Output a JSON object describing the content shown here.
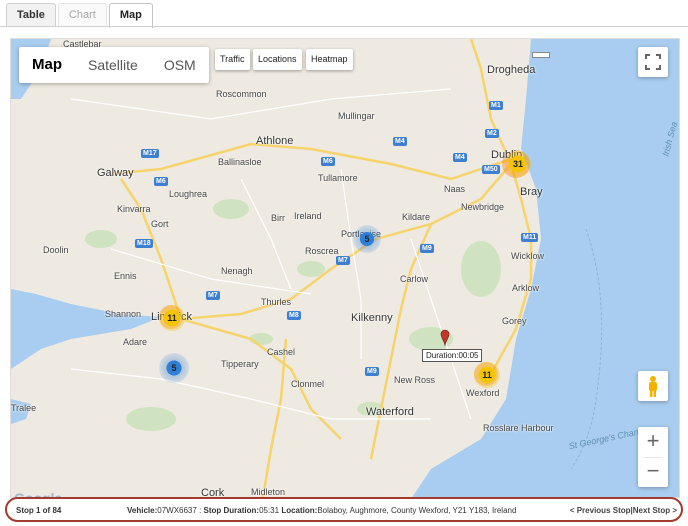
{
  "tabs": [
    {
      "label": "Table",
      "state": "normal"
    },
    {
      "label": "Chart",
      "state": "disabled"
    },
    {
      "label": "Map",
      "state": "active"
    }
  ],
  "map": {
    "type_buttons": [
      "Map",
      "Satellite",
      "OSM"
    ],
    "selected_type": "Map",
    "layer_buttons": [
      "Traffic",
      "Locations",
      "Heatmap"
    ],
    "fullscreen_icon": "fullscreen-icon",
    "pegman_icon": "pegman-icon",
    "zoom_in": "+",
    "zoom_out": "−",
    "attribution": "Google",
    "places": {
      "castlebar_region": "Castlebar",
      "roscommon": "Roscommon",
      "drogheda": "Drogheda",
      "mullingar": "Mullingar",
      "athlone": "Athlone",
      "ballinasloe": "Ballinasloe",
      "galway": "Galway",
      "loughrea": "Loughrea",
      "tullamore": "Tullamore",
      "dublin": "Dublin",
      "bray": "Bray",
      "naas": "Naas",
      "kinvarra": "Kinvarra",
      "gort": "Gort",
      "birr": "Birr",
      "ireland": "Ireland",
      "newbridge": "Newbridge",
      "kildare": "Kildare",
      "portlaoise": "Portlaoise",
      "roscrea": "Roscrea",
      "wicklow": "Wicklow",
      "doolin": "Doolin",
      "ennis": "Ennis",
      "nenagh": "Nenagh",
      "carlow": "Carlow",
      "arklow": "Arklow",
      "shannon": "Shannon",
      "limerick": "Limerick",
      "thurles": "Thurles",
      "kilkenny": "Kilkenny",
      "gorey": "Gorey",
      "adare": "Adare",
      "cashel": "Cashel",
      "tipperary": "Tipperary",
      "clonmel": "Clonmel",
      "new_ross": "New Ross",
      "tralee": "Tralee",
      "wexford": "Wexford",
      "waterford": "Waterford",
      "rosslare": "Rosslare Harbour",
      "cork": "Cork",
      "midleton": "Midleton",
      "irish_sea": "Irish Sea",
      "st_georges": "St George's Chan"
    },
    "roads": [
      "M17",
      "M6",
      "M4",
      "M1",
      "M2",
      "M50",
      "M11",
      "M7",
      "M8",
      "M9",
      "M18"
    ],
    "clusters": [
      {
        "count": "31",
        "color": "#f5c400"
      },
      {
        "count": "5",
        "color": "#2f7fd8"
      },
      {
        "count": "11",
        "color": "#f5c400"
      },
      {
        "count": "5",
        "color": "#2f7fd8"
      },
      {
        "count": "11",
        "color": "#f5c400"
      }
    ],
    "marker_tooltip": "Duration:00:05",
    "colors": {
      "water": "#a9cdf0",
      "land": "#eeeae1",
      "motorway": "#f7d36b",
      "accent": "#a33a2e"
    }
  },
  "status": {
    "stop": "Stop 1 of 84",
    "vehicle_label": "Vehicle:",
    "vehicle": "07WX6637",
    "sep": " : ",
    "duration_label": "Stop Duration:",
    "duration": "05:31",
    "location_label": "Location:",
    "location": "Bolaboy, Aughmore, County Wexford, Y21 Y183, Ireland",
    "prev": "< Previous Stop",
    "divider": "|",
    "next": "Next Stop >"
  }
}
